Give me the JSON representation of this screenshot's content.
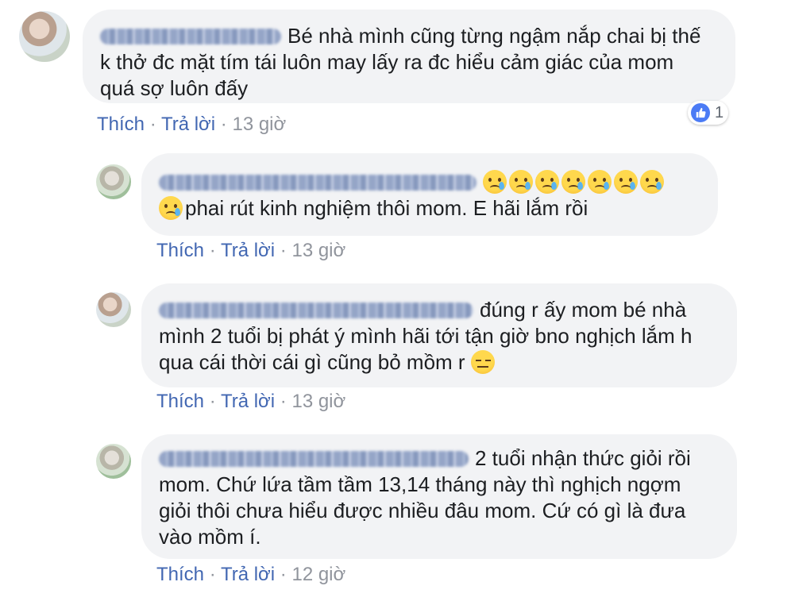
{
  "actions": {
    "like": "Thích",
    "reply": "Trả lời",
    "sep": "·"
  },
  "comments": [
    {
      "text_lines": [
        "Bé nhà mình cũng từng ngậm nắp chai bị thế",
        "k thở đc mặt tím tái luôn may lấy ra đc hiểu cảm giác của mom",
        "quá sợ luôn đấy"
      ],
      "time": "13 giờ",
      "reaction_count": "1",
      "reaction_icon": "thumbs-up-icon"
    },
    {
      "text_lines": [
        "",
        "phai rút kinh nghiệm thôi mom. E hãi lắm rồi"
      ],
      "emoji": "crying-face-icon",
      "time": "13 giờ"
    },
    {
      "text_lines": [
        "đúng r ấy mom bé nhà",
        "mình 2 tuổi bị phát ý mình hãi tới tận giờ bno nghịch lắm h",
        "qua cái thời cái gì cũng bỏ mồm r"
      ],
      "emoji": "persevering-face-icon",
      "time": "13 giờ"
    },
    {
      "text_lines": [
        "2 tuổi nhận thức giỏi rồi",
        "mom. Chứ lứa tầm tầm 13,14 tháng này thì nghịch ngợm",
        "giỏi thôi chưa hiểu được nhiều đâu mom. Cứ có gì là đưa",
        "vào mồm í."
      ],
      "time": "12 giờ"
    }
  ]
}
